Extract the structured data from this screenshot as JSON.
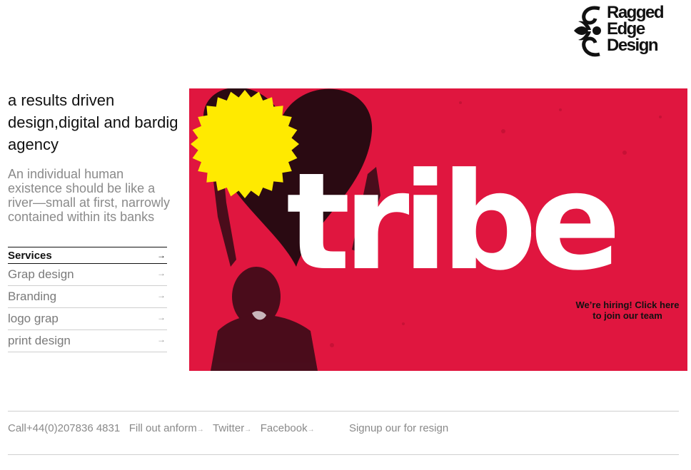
{
  "logo": {
    "lines": [
      "Ragged",
      "Edge",
      "Design"
    ]
  },
  "intro": {
    "tagline": "a results driven design,digital and bardig agency",
    "quote": "An individual human existence should be like a river—small at first, narrowly contained within its banks"
  },
  "services": {
    "title": "Services",
    "items": [
      "Grap design",
      "Branding",
      "logo grap",
      "print design"
    ]
  },
  "hero": {
    "word": "tribe",
    "badge": "We’re hiring! Click here to join our team",
    "colors": {
      "background": "#e0163f",
      "badge": "#ffea00"
    }
  },
  "footer": {
    "phone": "Call+44(0)207836 4831",
    "links": [
      "Fill out anform",
      "Twitter",
      "Facebook"
    ],
    "signup": "Signup our for resign"
  },
  "arrow": "→"
}
